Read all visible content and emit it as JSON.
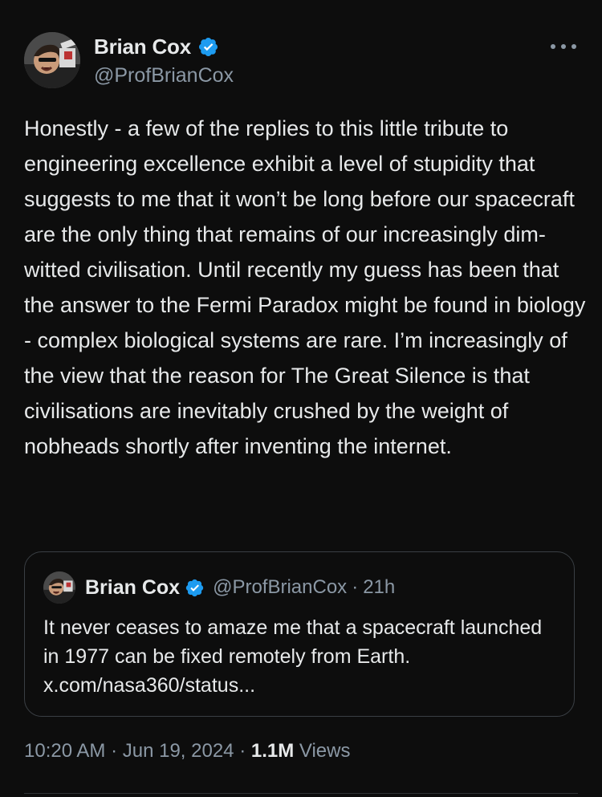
{
  "author": {
    "display_name": "Brian Cox",
    "handle": "@ProfBrianCox",
    "verified_icon": "verified-badge-icon"
  },
  "tweet": {
    "text": "Honestly - a few of the replies to this little tribute to engineering excellence exhibit a level of stupidity that suggests to me that it won’t be long before our spacecraft are the only thing that remains of our increasingly dim-witted civilisation. Until recently my guess has been that the answer to the Fermi Paradox might be found in biology - complex biological systems are rare. I’m increasingly of the view that the reason for The Great Silence is that civilisations are inevitably crushed by the weight of nobheads shortly after inventing the internet.",
    "more_icon": "more-options-icon"
  },
  "quoted_tweet": {
    "display_name": "Brian Cox",
    "handle": "@ProfBrianCox",
    "separator": "·",
    "time": "21h",
    "text": "It never ceases to amaze me that a spacecraft launched in 1977 can be fixed remotely from Earth. x.com/nasa360/status..."
  },
  "meta": {
    "time": "10:20 AM",
    "sep1": " · ",
    "date": "Jun 19, 2024",
    "sep2": " · ",
    "views_count": "1.1M",
    "views_label": " Views"
  },
  "colors": {
    "background": "#0d0d0d",
    "text_primary": "#e7e9ea",
    "text_secondary": "#8b98a5",
    "verified_blue": "#1d9bf0"
  }
}
